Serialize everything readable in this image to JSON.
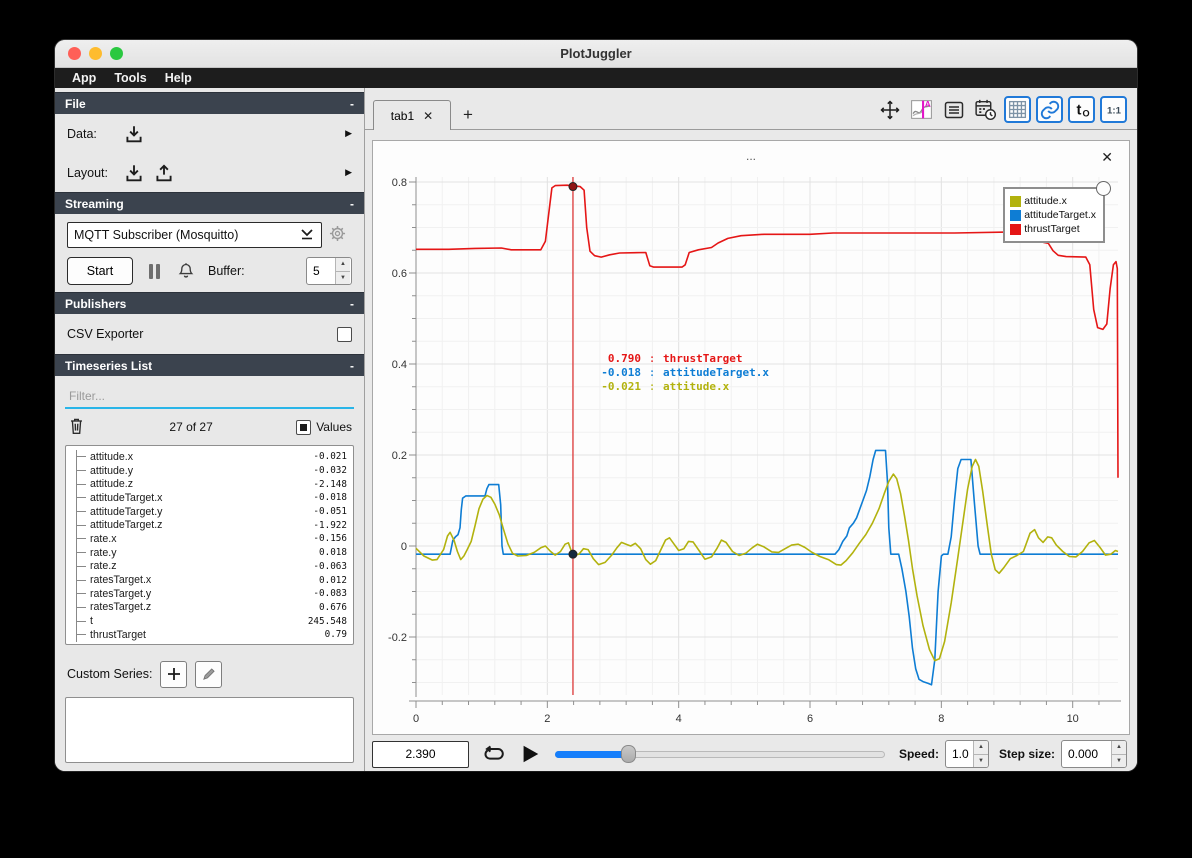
{
  "window": {
    "title": "PlotJuggler"
  },
  "menu": {
    "items": [
      "App",
      "Tools",
      "Help"
    ]
  },
  "icons": {
    "expand": "▶",
    "close": "✕",
    "spin_up": "▲",
    "spin_down": "▼"
  },
  "sidebar": {
    "file": {
      "title": "File",
      "collapse": "-",
      "data_label": "Data:",
      "layout_label": "Layout:"
    },
    "streaming": {
      "title": "Streaming",
      "collapse": "-",
      "source": "MQTT Subscriber (Mosquitto)",
      "start_label": "Start",
      "buffer_label": "Buffer:",
      "buffer_value": "5"
    },
    "publishers": {
      "title": "Publishers",
      "collapse": "-",
      "csv_label": "CSV Exporter",
      "csv_checked": false
    },
    "timeseries": {
      "title": "Timeseries List",
      "collapse": "-",
      "filter_placeholder": "Filter...",
      "count": "27 of 27",
      "values_label": "Values",
      "values_checked": true,
      "items": [
        {
          "name": "attitude.x",
          "value": "-0.021"
        },
        {
          "name": "attitude.y",
          "value": "-0.032"
        },
        {
          "name": "attitude.z",
          "value": "-2.148"
        },
        {
          "name": "attitudeTarget.x",
          "value": "-0.018"
        },
        {
          "name": "attitudeTarget.y",
          "value": "-0.051"
        },
        {
          "name": "attitudeTarget.z",
          "value": "-1.922"
        },
        {
          "name": "rate.x",
          "value": "-0.156"
        },
        {
          "name": "rate.y",
          "value": "0.018"
        },
        {
          "name": "rate.z",
          "value": "-0.063"
        },
        {
          "name": "ratesTarget.x",
          "value": "0.012"
        },
        {
          "name": "ratesTarget.y",
          "value": "-0.083"
        },
        {
          "name": "ratesTarget.z",
          "value": "0.676"
        },
        {
          "name": "t",
          "value": "245.548"
        },
        {
          "name": "thrustTarget",
          "value": "0.79"
        }
      ],
      "custom_series_label": "Custom Series:"
    }
  },
  "tabs": {
    "active_label": "tab1",
    "add_label": "+"
  },
  "plot": {
    "title": "...",
    "legend": [
      {
        "label": "attitude.x",
        "color": "#b2b20e"
      },
      {
        "label": "attitudeTarget.x",
        "color": "#0e7dd4"
      },
      {
        "label": "thrustTarget",
        "color": "#e51616"
      }
    ],
    "tooltip": [
      {
        "value": "0.790",
        "name": "thrustTarget",
        "color": "#e51616"
      },
      {
        "value": "-0.018",
        "name": "attitudeTarget.x",
        "color": "#0e7dd4"
      },
      {
        "value": "-0.021",
        "name": "attitude.x",
        "color": "#b2b20e"
      }
    ]
  },
  "chart_data": {
    "type": "line",
    "title": "...",
    "xlabel": "",
    "ylabel": "",
    "xlim": [
      0,
      10.69
    ],
    "ylim": [
      -0.3275,
      0.811
    ],
    "x_ticks": [
      0,
      2,
      4,
      6,
      8,
      10
    ],
    "x_minor_step": 0.4,
    "y_ticks": [
      -0.2,
      0,
      0.2,
      0.4,
      0.6,
      0.8
    ],
    "y_minor_step": 0.05,
    "grid": true,
    "legend_position": "top-right",
    "tracker": {
      "x": 2.39,
      "markers": [
        {
          "y": 0.79,
          "fill": "#8f1414"
        },
        {
          "y": -0.018,
          "fill": "#14293e"
        }
      ]
    },
    "series": [
      {
        "name": "thrustTarget",
        "color": "#e51616",
        "points": [
          [
            0,
            0.652
          ],
          [
            0.5,
            0.652
          ],
          [
            0.9,
            0.654
          ],
          [
            1.3,
            0.655
          ],
          [
            1.45,
            0.651
          ],
          [
            1.9,
            0.651
          ],
          [
            1.97,
            0.67
          ],
          [
            2.02,
            0.73
          ],
          [
            2.07,
            0.787
          ],
          [
            2.12,
            0.792
          ],
          [
            2.3,
            0.793
          ],
          [
            2.5,
            0.79
          ],
          [
            2.56,
            0.782
          ],
          [
            2.6,
            0.7
          ],
          [
            2.65,
            0.648
          ],
          [
            2.72,
            0.638
          ],
          [
            2.82,
            0.635
          ],
          [
            2.95,
            0.64
          ],
          [
            3.1,
            0.644
          ],
          [
            3.5,
            0.645
          ],
          [
            3.56,
            0.616
          ],
          [
            3.62,
            0.613
          ],
          [
            4.05,
            0.613
          ],
          [
            4.1,
            0.618
          ],
          [
            4.16,
            0.645
          ],
          [
            4.3,
            0.651
          ],
          [
            4.5,
            0.656
          ],
          [
            4.6,
            0.666
          ],
          [
            4.75,
            0.676
          ],
          [
            4.95,
            0.682
          ],
          [
            5.3,
            0.685
          ],
          [
            6.0,
            0.685
          ],
          [
            6.35,
            0.688
          ],
          [
            7.2,
            0.688
          ],
          [
            8.2,
            0.688
          ],
          [
            9.0,
            0.69
          ],
          [
            9.3,
            0.69
          ],
          [
            9.36,
            0.682
          ],
          [
            9.5,
            0.68
          ],
          [
            9.56,
            0.667
          ],
          [
            9.63,
            0.665
          ],
          [
            9.7,
            0.649
          ],
          [
            9.78,
            0.639
          ],
          [
            9.9,
            0.636
          ],
          [
            10.2,
            0.635
          ],
          [
            10.26,
            0.618
          ],
          [
            10.32,
            0.52
          ],
          [
            10.38,
            0.48
          ],
          [
            10.46,
            0.476
          ],
          [
            10.52,
            0.488
          ],
          [
            10.57,
            0.565
          ],
          [
            10.62,
            0.618
          ],
          [
            10.66,
            0.625
          ],
          [
            10.68,
            0.61
          ],
          [
            10.69,
            0.15
          ]
        ]
      },
      {
        "name": "attitudeTarget.x",
        "color": "#0e7dd4",
        "points": [
          [
            0,
            -0.018
          ],
          [
            0.52,
            -0.018
          ],
          [
            0.56,
            0.012
          ],
          [
            0.6,
            0.02
          ],
          [
            0.64,
            0.025
          ],
          [
            0.67,
            0.04
          ],
          [
            0.69,
            0.08
          ],
          [
            0.71,
            0.105
          ],
          [
            0.76,
            0.11
          ],
          [
            1.05,
            0.11
          ],
          [
            1.08,
            0.126
          ],
          [
            1.11,
            0.135
          ],
          [
            1.26,
            0.135
          ],
          [
            1.29,
            0.09
          ],
          [
            1.31,
            0.0
          ],
          [
            1.33,
            -0.018
          ],
          [
            6.38,
            -0.018
          ],
          [
            6.44,
            -0.008
          ],
          [
            6.5,
            0.01
          ],
          [
            6.56,
            0.022
          ],
          [
            6.6,
            0.04
          ],
          [
            6.66,
            0.05
          ],
          [
            6.71,
            0.062
          ],
          [
            6.76,
            0.082
          ],
          [
            6.81,
            0.102
          ],
          [
            6.86,
            0.122
          ],
          [
            6.91,
            0.152
          ],
          [
            6.96,
            0.19
          ],
          [
            7.0,
            0.21
          ],
          [
            7.15,
            0.21
          ],
          [
            7.18,
            0.14
          ],
          [
            7.2,
            0.04
          ],
          [
            7.23,
            -0.018
          ],
          [
            7.35,
            -0.018
          ],
          [
            7.4,
            -0.05
          ],
          [
            7.46,
            -0.1
          ],
          [
            7.51,
            -0.155
          ],
          [
            7.56,
            -0.225
          ],
          [
            7.61,
            -0.27
          ],
          [
            7.66,
            -0.293
          ],
          [
            7.72,
            -0.298
          ],
          [
            7.8,
            -0.302
          ],
          [
            7.85,
            -0.305
          ],
          [
            7.9,
            -0.25
          ],
          [
            7.95,
            -0.1
          ],
          [
            8.0,
            -0.022
          ],
          [
            8.03,
            -0.018
          ],
          [
            8.1,
            -0.018
          ],
          [
            8.15,
            0.02
          ],
          [
            8.2,
            0.1
          ],
          [
            8.25,
            0.17
          ],
          [
            8.3,
            0.19
          ],
          [
            8.45,
            0.19
          ],
          [
            8.5,
            0.1
          ],
          [
            8.56,
            0.0
          ],
          [
            8.59,
            -0.018
          ],
          [
            10.69,
            -0.018
          ]
        ]
      },
      {
        "name": "attitude.x",
        "color": "#b2b20e",
        "points": [
          [
            0,
            -0.005
          ],
          [
            0.12,
            -0.022
          ],
          [
            0.25,
            -0.031
          ],
          [
            0.32,
            -0.03
          ],
          [
            0.42,
            -0.008
          ],
          [
            0.48,
            0.022
          ],
          [
            0.52,
            0.03
          ],
          [
            0.58,
            0.012
          ],
          [
            0.63,
            -0.012
          ],
          [
            0.68,
            -0.03
          ],
          [
            0.73,
            -0.022
          ],
          [
            0.78,
            -0.008
          ],
          [
            0.84,
            0.01
          ],
          [
            0.9,
            0.045
          ],
          [
            0.96,
            0.082
          ],
          [
            1.02,
            0.103
          ],
          [
            1.08,
            0.111
          ],
          [
            1.14,
            0.107
          ],
          [
            1.2,
            0.092
          ],
          [
            1.27,
            0.068
          ],
          [
            1.33,
            0.038
          ],
          [
            1.4,
            0.005
          ],
          [
            1.47,
            -0.016
          ],
          [
            1.55,
            -0.022
          ],
          [
            1.68,
            -0.021
          ],
          [
            1.8,
            -0.014
          ],
          [
            1.9,
            -0.004
          ],
          [
            1.97,
            0.0
          ],
          [
            2.05,
            -0.012
          ],
          [
            2.12,
            -0.02
          ],
          [
            2.2,
            -0.012
          ],
          [
            2.27,
            0.004
          ],
          [
            2.32,
            0.007
          ],
          [
            2.39,
            -0.021
          ],
          [
            2.48,
            -0.018
          ],
          [
            2.55,
            -0.006
          ],
          [
            2.62,
            -0.008
          ],
          [
            2.7,
            -0.028
          ],
          [
            2.78,
            -0.041
          ],
          [
            2.88,
            -0.036
          ],
          [
            2.98,
            -0.02
          ],
          [
            3.06,
            -0.004
          ],
          [
            3.13,
            0.008
          ],
          [
            3.2,
            0.004
          ],
          [
            3.27,
            0.0
          ],
          [
            3.34,
            0.006
          ],
          [
            3.42,
            -0.006
          ],
          [
            3.5,
            -0.03
          ],
          [
            3.57,
            -0.04
          ],
          [
            3.65,
            -0.032
          ],
          [
            3.73,
            -0.008
          ],
          [
            3.8,
            0.013
          ],
          [
            3.86,
            0.018
          ],
          [
            3.93,
            0.004
          ],
          [
            4.0,
            -0.01
          ],
          [
            4.08,
            -0.006
          ],
          [
            4.15,
            0.01
          ],
          [
            4.22,
            0.009
          ],
          [
            4.32,
            -0.012
          ],
          [
            4.4,
            -0.029
          ],
          [
            4.5,
            -0.024
          ],
          [
            4.58,
            -0.006
          ],
          [
            4.65,
            0.013
          ],
          [
            4.72,
            0.008
          ],
          [
            4.82,
            -0.012
          ],
          [
            4.92,
            -0.021
          ],
          [
            5.02,
            -0.016
          ],
          [
            5.12,
            -0.004
          ],
          [
            5.2,
            0.004
          ],
          [
            5.3,
            -0.002
          ],
          [
            5.42,
            -0.013
          ],
          [
            5.52,
            -0.014
          ],
          [
            5.62,
            -0.006
          ],
          [
            5.72,
            0.002
          ],
          [
            5.82,
            0.004
          ],
          [
            5.92,
            -0.003
          ],
          [
            6.02,
            -0.013
          ],
          [
            6.15,
            -0.023
          ],
          [
            6.28,
            -0.03
          ],
          [
            6.4,
            -0.041
          ],
          [
            6.47,
            -0.042
          ],
          [
            6.55,
            -0.032
          ],
          [
            6.65,
            -0.015
          ],
          [
            6.75,
            0.006
          ],
          [
            6.85,
            0.025
          ],
          [
            6.95,
            0.05
          ],
          [
            7.05,
            0.082
          ],
          [
            7.13,
            0.115
          ],
          [
            7.2,
            0.142
          ],
          [
            7.27,
            0.158
          ],
          [
            7.32,
            0.148
          ],
          [
            7.38,
            0.115
          ],
          [
            7.44,
            0.065
          ],
          [
            7.5,
            0.012
          ],
          [
            7.56,
            -0.05
          ],
          [
            7.63,
            -0.11
          ],
          [
            7.72,
            -0.175
          ],
          [
            7.82,
            -0.228
          ],
          [
            7.9,
            -0.252
          ],
          [
            7.97,
            -0.248
          ],
          [
            8.05,
            -0.21
          ],
          [
            8.15,
            -0.125
          ],
          [
            8.25,
            -0.026
          ],
          [
            8.32,
            0.045
          ],
          [
            8.4,
            0.125
          ],
          [
            8.47,
            0.175
          ],
          [
            8.52,
            0.19
          ],
          [
            8.57,
            0.175
          ],
          [
            8.63,
            0.12
          ],
          [
            8.7,
            0.045
          ],
          [
            8.76,
            -0.018
          ],
          [
            8.82,
            -0.052
          ],
          [
            8.88,
            -0.06
          ],
          [
            8.95,
            -0.048
          ],
          [
            9.05,
            -0.028
          ],
          [
            9.15,
            -0.021
          ],
          [
            9.25,
            -0.012
          ],
          [
            9.35,
            0.028
          ],
          [
            9.42,
            0.036
          ],
          [
            9.48,
            0.018
          ],
          [
            9.55,
            0.008
          ],
          [
            9.62,
            0.02
          ],
          [
            9.68,
            0.018
          ],
          [
            9.75,
            0.002
          ],
          [
            9.85,
            -0.012
          ],
          [
            9.95,
            -0.023
          ],
          [
            10.05,
            -0.024
          ],
          [
            10.15,
            -0.012
          ],
          [
            10.25,
            0.007
          ],
          [
            10.33,
            0.012
          ],
          [
            10.42,
            -0.004
          ],
          [
            10.5,
            -0.02
          ],
          [
            10.58,
            -0.018
          ],
          [
            10.65,
            -0.01
          ],
          [
            10.69,
            -0.012
          ]
        ]
      }
    ]
  },
  "playback": {
    "time": "2.390",
    "slider_fraction": 0.22,
    "speed_label": "Speed:",
    "speed_value": "1.0",
    "step_label": "Step size:",
    "step_value": "0.000"
  }
}
